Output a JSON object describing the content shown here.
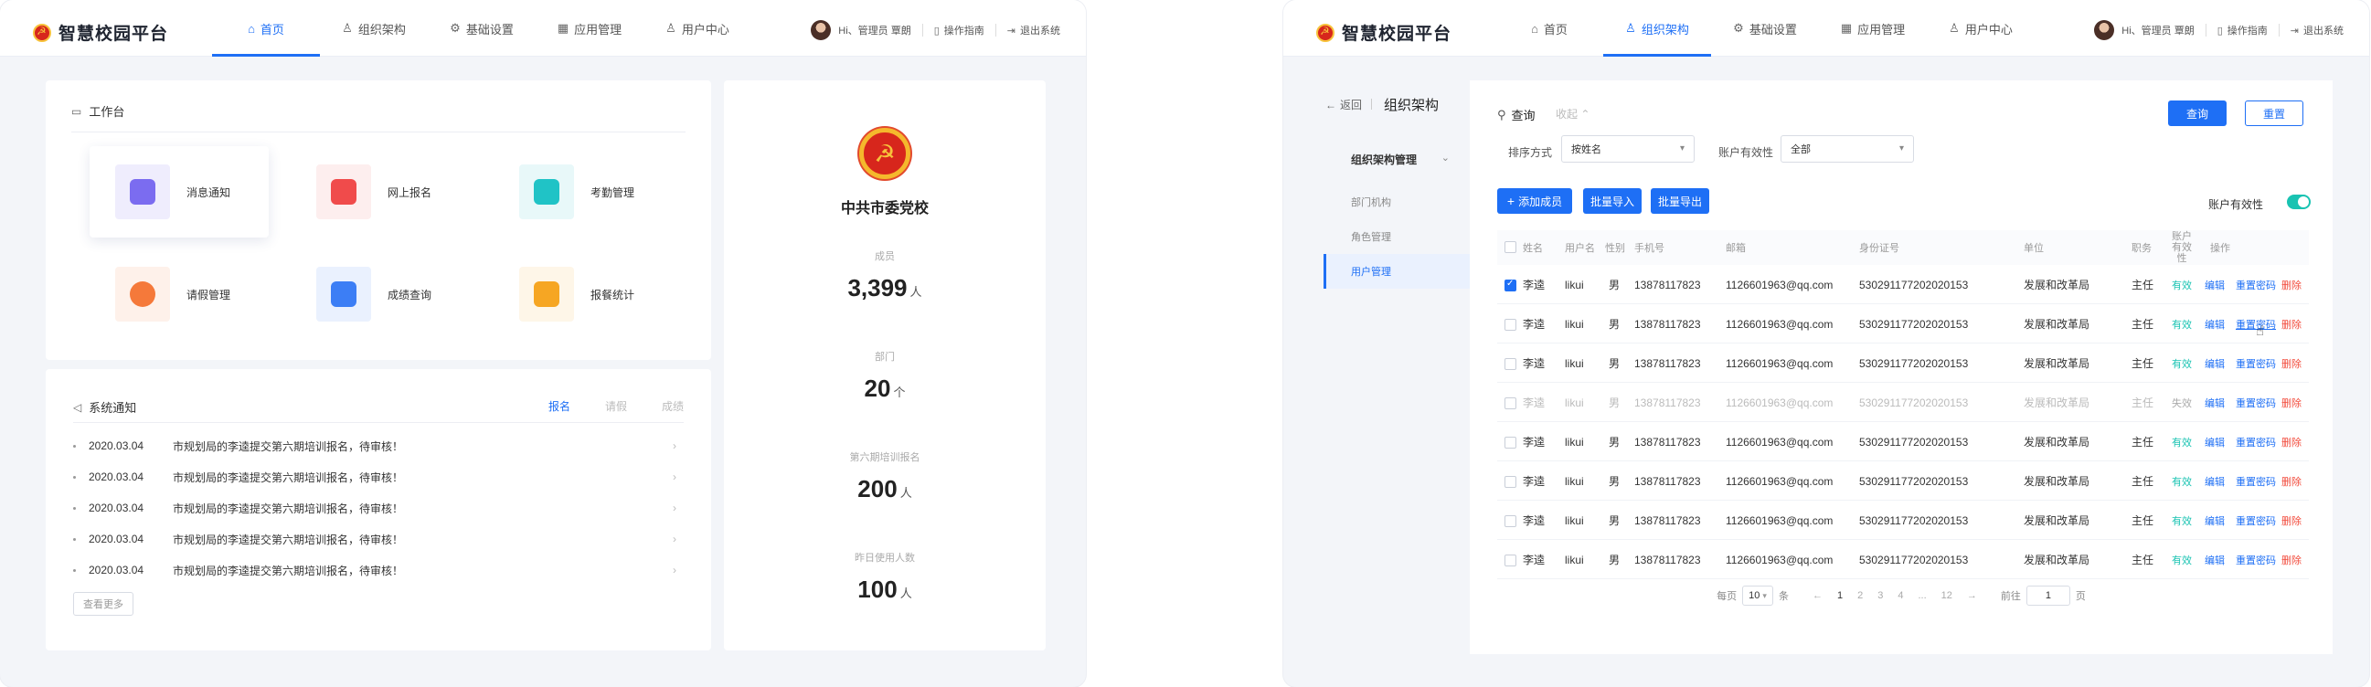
{
  "left": {
    "header": {
      "brand": "智慧校园平台",
      "nav": [
        {
          "label": "首页",
          "icon": "home-icon"
        },
        {
          "label": "组织架构",
          "icon": "user-icon"
        },
        {
          "label": "基础设置",
          "icon": "gear-icon"
        },
        {
          "label": "应用管理",
          "icon": "apps-icon"
        },
        {
          "label": "用户中心",
          "icon": "person-icon"
        }
      ],
      "active_nav": "首页",
      "greeting": "Hi、管理员 覃朗",
      "guide": "操作指南",
      "logout": "退出系统"
    },
    "workbench": {
      "title": "工作台",
      "tiles": [
        {
          "label": "消息通知",
          "icon": "message-icon",
          "color": "#7b6cf0",
          "bg": "#efedfd"
        },
        {
          "label": "网上报名",
          "icon": "edit-icon",
          "color": "#f04b4b",
          "bg": "#fdeeee"
        },
        {
          "label": "考勤管理",
          "icon": "calendar-check-icon",
          "color": "#20c3c6",
          "bg": "#e8f8f9"
        },
        {
          "label": "请假管理",
          "icon": "person-icon",
          "color": "#f5793a",
          "bg": "#fef1ea"
        },
        {
          "label": "成绩查询",
          "icon": "search-doc-icon",
          "color": "#3c7ef5",
          "bg": "#eaf1fe"
        },
        {
          "label": "报餐统计",
          "icon": "cutlery-icon",
          "color": "#f6a623",
          "bg": "#fef6e8"
        }
      ]
    },
    "notices": {
      "title": "系统通知",
      "tabs": [
        "报名",
        "请假",
        "成绩"
      ],
      "active_tab": "报名",
      "items": [
        {
          "date": "2020.03.04",
          "text": "市规划局的李逵提交第六期培训报名，待审核！"
        },
        {
          "date": "2020.03.04",
          "text": "市规划局的李逵提交第六期培训报名，待审核！"
        },
        {
          "date": "2020.03.04",
          "text": "市规划局的李逵提交第六期培训报名，待审核！"
        },
        {
          "date": "2020.03.04",
          "text": "市规划局的李逵提交第六期培训报名，待审核！"
        },
        {
          "date": "2020.03.04",
          "text": "市规划局的李逵提交第六期培训报名，待审核！"
        }
      ],
      "more": "查看更多"
    },
    "profile": {
      "name": "中共市委党校",
      "stats": [
        {
          "label": "成员",
          "value": "3,399",
          "unit": "人"
        },
        {
          "label": "部门",
          "value": "20",
          "unit": "个"
        },
        {
          "label": "第六期培训报名",
          "value": "200",
          "unit": "人"
        },
        {
          "label": "昨日使用人数",
          "value": "100",
          "unit": "人"
        }
      ]
    }
  },
  "right": {
    "header": {
      "brand": "智慧校园平台",
      "nav": [
        {
          "label": "首页",
          "icon": "home-icon"
        },
        {
          "label": "组织架构",
          "icon": "user-icon"
        },
        {
          "label": "基础设置",
          "icon": "gear-icon"
        },
        {
          "label": "应用管理",
          "icon": "apps-icon"
        },
        {
          "label": "用户中心",
          "icon": "person-icon"
        }
      ],
      "active_nav": "组织架构",
      "greeting": "Hi、管理员 覃朗",
      "guide": "操作指南",
      "logout": "退出系统"
    },
    "sidebar": {
      "back": "返回",
      "title": "组织架构",
      "group": "组织架构管理",
      "items": [
        "部门机构",
        "角色管理",
        "用户管理"
      ],
      "active_item": "用户管理"
    },
    "query": {
      "title": "查询",
      "collapse": "收起",
      "search_btn": "查询",
      "reset_btn": "重置",
      "sort_label": "排序方式",
      "sort_value": "按姓名",
      "validity_label": "账户有效性",
      "validity_value": "全部"
    },
    "toolbar": {
      "add": "添加成员",
      "import": "批量导入",
      "export": "批量导出",
      "toggle_label": "账户有效性",
      "toggle_on": true
    },
    "table": {
      "columns": [
        "姓名",
        "用户名",
        "性别",
        "手机号",
        "邮箱",
        "身份证号",
        "单位",
        "职务",
        "账户有效性",
        "操作"
      ],
      "rows": [
        {
          "name": "李逵",
          "username": "likui",
          "gender": "男",
          "phone": "13878117823",
          "email": "1126601963@qq.com",
          "id": "530291177202020153",
          "unit": "发展和改革局",
          "title": "主任",
          "status": "有效",
          "checked": true
        },
        {
          "name": "李逵",
          "username": "likui",
          "gender": "男",
          "phone": "13878117823",
          "email": "1126601963@qq.com",
          "id": "530291177202020153",
          "unit": "发展和改革局",
          "title": "主任",
          "status": "有效",
          "checked": false
        },
        {
          "name": "李逵",
          "username": "likui",
          "gender": "男",
          "phone": "13878117823",
          "email": "1126601963@qq.com",
          "id": "530291177202020153",
          "unit": "发展和改革局",
          "title": "主任",
          "status": "有效",
          "checked": false
        },
        {
          "name": "李逵",
          "username": "likui",
          "gender": "男",
          "phone": "13878117823",
          "email": "1126601963@qq.com",
          "id": "530291177202020153",
          "unit": "发展和改革局",
          "title": "主任",
          "status": "失效",
          "checked": false
        },
        {
          "name": "李逵",
          "username": "likui",
          "gender": "男",
          "phone": "13878117823",
          "email": "1126601963@qq.com",
          "id": "530291177202020153",
          "unit": "发展和改革局",
          "title": "主任",
          "status": "有效",
          "checked": false
        },
        {
          "name": "李逵",
          "username": "likui",
          "gender": "男",
          "phone": "13878117823",
          "email": "1126601963@qq.com",
          "id": "530291177202020153",
          "unit": "发展和改革局",
          "title": "主任",
          "status": "有效",
          "checked": false
        },
        {
          "name": "李逵",
          "username": "likui",
          "gender": "男",
          "phone": "13878117823",
          "email": "1126601963@qq.com",
          "id": "530291177202020153",
          "unit": "发展和改革局",
          "title": "主任",
          "status": "有效",
          "checked": false
        },
        {
          "name": "李逵",
          "username": "likui",
          "gender": "男",
          "phone": "13878117823",
          "email": "1126601963@qq.com",
          "id": "530291177202020153",
          "unit": "发展和改革局",
          "title": "主任",
          "status": "有效",
          "checked": false
        }
      ],
      "actions": {
        "edit": "编辑",
        "reset": "重置密码",
        "delete": "删除"
      }
    },
    "pager": {
      "per_page_label": "每页",
      "per_page_value": "10",
      "per_page_unit": "条",
      "pages": [
        "1",
        "2",
        "3",
        "4",
        "...",
        "12"
      ],
      "current": "1",
      "goto_label": "前往",
      "goto_value": "1",
      "goto_unit": "页"
    }
  },
  "colors": {
    "accent": "#1e6ff5",
    "valid": "#19c3b2",
    "danger": "#f24b3c"
  }
}
